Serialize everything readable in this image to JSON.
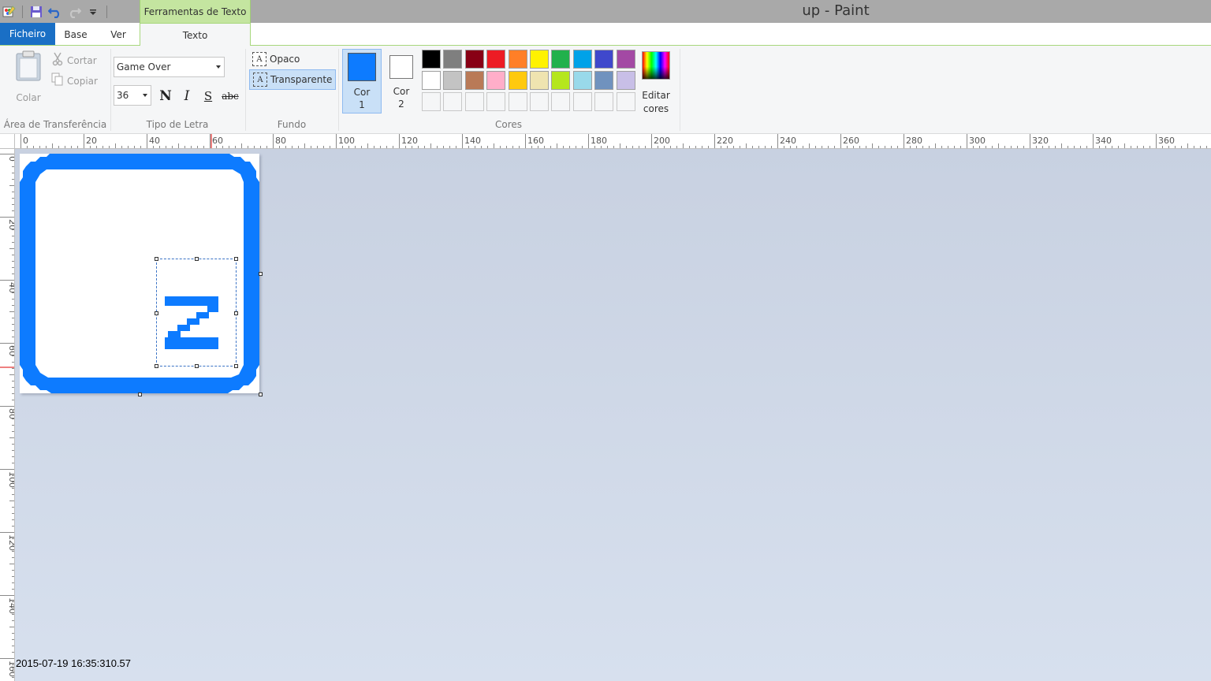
{
  "window": {
    "title": "up - Paint",
    "context_tab": "Ferramentas de Texto"
  },
  "quick_access": [
    "paint-app-icon",
    "save-icon",
    "undo-icon",
    "redo-icon",
    "customize-dropdown-icon"
  ],
  "tabs": {
    "file": "Ficheiro",
    "home": "Base",
    "view": "Ver",
    "text": "Texto"
  },
  "clipboard": {
    "paste": "Colar",
    "cut": "Cortar",
    "copy": "Copiar",
    "group_label": "Área de Transferência"
  },
  "font": {
    "family": "Game Over",
    "size": "36",
    "bold": "N",
    "italic": "I",
    "underline": "S",
    "strikethrough": "abc",
    "group_label": "Tipo de Letra"
  },
  "background": {
    "opaque": "Opaco",
    "transparent": "Transparente",
    "selected": "transparent",
    "group_label": "Fundo"
  },
  "colors": {
    "color1_label_line1": "Cor",
    "color1_label_line2": "1",
    "color2_label_line1": "Cor",
    "color2_label_line2": "2",
    "color1": "#0d7bff",
    "color2": "#ffffff",
    "edit_line1": "Editar",
    "edit_line2": "cores",
    "group_label": "Cores",
    "palette": [
      "#000000",
      "#7f7f7f",
      "#880015",
      "#ed1c24",
      "#ff7f27",
      "#fff200",
      "#22b14c",
      "#00a2e8",
      "#3f48cc",
      "#a349a4",
      "#ffffff",
      "#c3c3c3",
      "#b97a57",
      "#ffaec9",
      "#ffc90e",
      "#efe4b0",
      "#b5e61d",
      "#99d9ea",
      "#7092be",
      "#c8bfe7",
      "#f5f6f7",
      "#f5f6f7",
      "#f5f6f7",
      "#f5f6f7",
      "#f5f6f7",
      "#f5f6f7",
      "#f5f6f7",
      "#f5f6f7",
      "#f5f6f7",
      "#f5f6f7"
    ]
  },
  "rulers": {
    "horizontal": [
      "0",
      "20",
      "40",
      "60",
      "80",
      "100",
      "120",
      "140",
      "160",
      "180",
      "200",
      "220",
      "240",
      "260",
      "280",
      "300",
      "320",
      "340",
      "360"
    ],
    "vertical": [
      "0",
      "20",
      "40",
      "60",
      "80",
      "100",
      "120",
      "140",
      "160"
    ]
  },
  "canvas": {
    "drawing_color": "#0d7bff",
    "glyph": "z"
  },
  "timestamp": "2015-07-19 16:35:310.57"
}
